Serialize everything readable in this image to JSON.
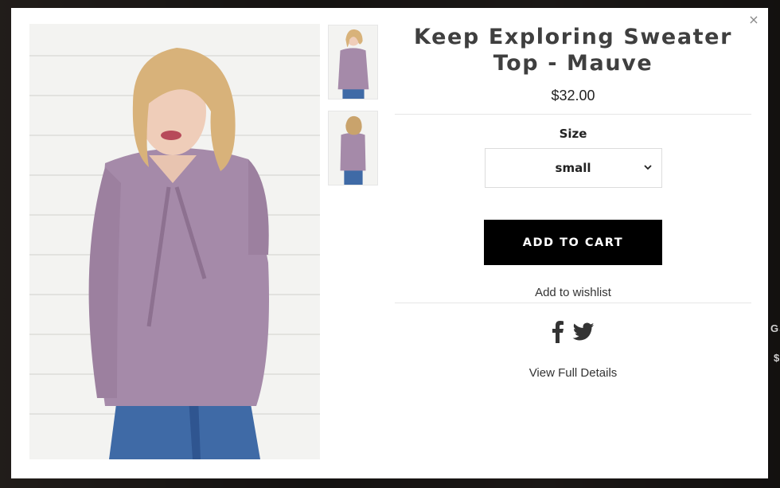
{
  "background": {
    "peek_text": "GS",
    "peek_text2": "$"
  },
  "modal": {
    "close_icon": "×",
    "product": {
      "title": "Keep Exploring Sweater Top - Mauve",
      "price": "$32.00",
      "size_label": "Size",
      "size_selected": "small",
      "add_to_cart": "ADD TO CART",
      "wishlist": "Add to wishlist",
      "view_details": "View Full Details"
    },
    "icons": [
      "close-icon",
      "chevron-down-icon",
      "facebook-icon",
      "twitter-icon"
    ],
    "colors": {
      "button_bg": "#000000",
      "button_text": "#ffffff",
      "sweater": "#a58aa9",
      "title": "#3f3f3f"
    }
  }
}
